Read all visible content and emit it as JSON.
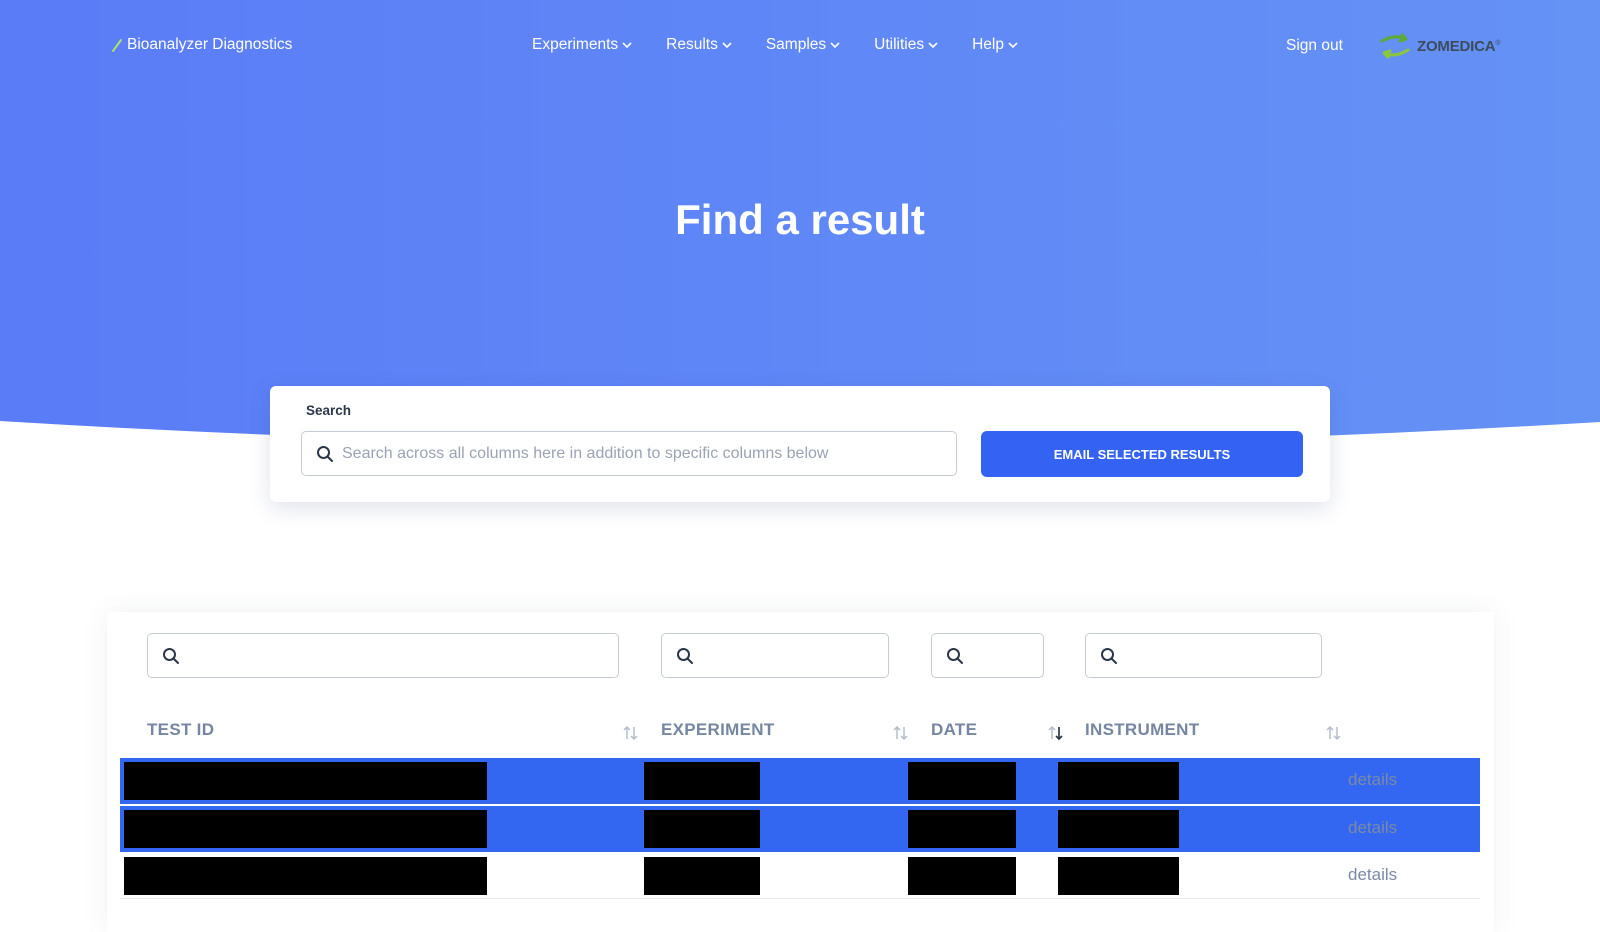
{
  "nav": {
    "brand": "Bioanalyzer Diagnostics",
    "menu": [
      {
        "label": "Experiments"
      },
      {
        "label": "Results"
      },
      {
        "label": "Samples"
      },
      {
        "label": "Utilities"
      },
      {
        "label": "Help"
      }
    ],
    "sign_out": "Sign out",
    "logo_text": "ZOMEDICA",
    "logo_mark": "®"
  },
  "hero": {
    "title": "Find a result"
  },
  "search": {
    "label": "Search",
    "placeholder": "Search across all columns here in addition to specific columns below",
    "email_button": "EMAIL SELECTED RESULTS"
  },
  "table": {
    "columns": [
      {
        "label": "TEST ID",
        "sort_icon": "sort-icon"
      },
      {
        "label": "EXPERIMENT",
        "sort_icon": "sort-icon"
      },
      {
        "label": "DATE",
        "sort_icon": "sort-desc-icon"
      },
      {
        "label": "INSTRUMENT",
        "sort_icon": "sort-icon"
      }
    ],
    "rows": [
      {
        "selected": true,
        "details": "details"
      },
      {
        "selected": true,
        "details": "details"
      },
      {
        "selected": false,
        "details": "details"
      }
    ]
  },
  "colors": {
    "hero_start": "#5a7cf7",
    "hero_end": "#6592f5",
    "primary_button": "#3463f3",
    "selected_row": "#3366f1",
    "header_text": "#7686a2",
    "redaction": "#000000"
  }
}
